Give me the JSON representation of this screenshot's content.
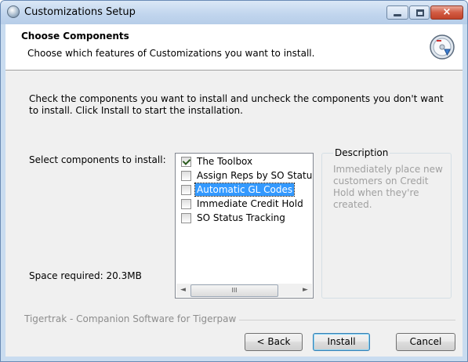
{
  "window": {
    "title": "Customizations Setup",
    "controls": {
      "minimize": "minimize",
      "maximize": "maximize",
      "close": "×"
    }
  },
  "header": {
    "title": "Choose Components",
    "subtitle": "Choose which features of Customizations you want to install.",
    "icon": "installer-disc-icon"
  },
  "intro": "Check the components you want to install and uncheck the components you don't want to install. Click Install to start the installation.",
  "select_label": "Select components to install:",
  "space_label": "Space required: 20.3MB",
  "components": [
    {
      "label": "The Toolbox",
      "checked": true,
      "selected": false
    },
    {
      "label": "Assign Reps by SO Status",
      "checked": false,
      "selected": false
    },
    {
      "label": "Automatic GL Codes",
      "checked": false,
      "selected": true
    },
    {
      "label": "Immediate Credit Hold",
      "checked": false,
      "selected": false
    },
    {
      "label": "SO Status Tracking",
      "checked": false,
      "selected": false
    }
  ],
  "scrollbar": {
    "left": "◄",
    "right": "►",
    "thumb": "III"
  },
  "description": {
    "legend": "Description",
    "text": "Immediately place new customers on Credit Hold when they're created."
  },
  "branding": "Tigertrak - Companion Software for Tigerpaw",
  "buttons": {
    "back": "< Back",
    "install": "Install",
    "cancel": "Cancel"
  },
  "colors": {
    "selection": "#3399ff",
    "description_text": "#a0a0a0",
    "close_button": "#d25b43"
  }
}
